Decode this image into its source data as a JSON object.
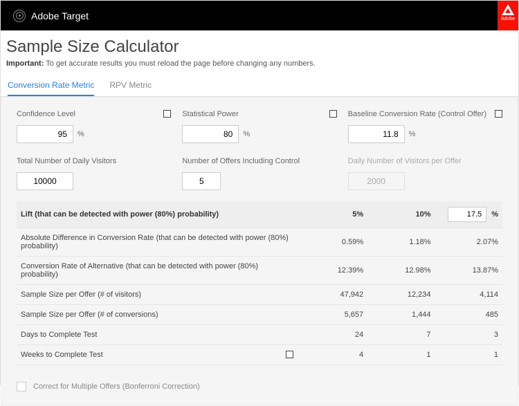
{
  "header": {
    "brand": "Adobe Target",
    "adobe_label": "Adobe"
  },
  "title": "Sample Size Calculator",
  "note_bold": "Important:",
  "note_text": " To get accurate results you must reload the page before changing any numbers.",
  "tabs": {
    "conversion": "Conversion Rate Metric",
    "rpv": "RPV Metric"
  },
  "inputs": {
    "confidence": {
      "label": "Confidence Level",
      "value": "95",
      "unit": "%"
    },
    "power": {
      "label": "Statistical Power",
      "value": "80",
      "unit": "%"
    },
    "baseline": {
      "label": "Baseline Conversion Rate (Control Offer)",
      "value": "11.8",
      "unit": "%"
    },
    "daily": {
      "label": "Total Number of Daily Visitors",
      "value": "10000"
    },
    "offers": {
      "label": "Number of Offers Including Control",
      "value": "5"
    },
    "perOffer": {
      "label": "Daily Number of Visitors per Offer",
      "value": "2000"
    }
  },
  "tableHeader": {
    "lift": "Lift (that can be detected with power (80%) probability)",
    "col5": "5%",
    "col10": "10%",
    "colCustom": "17.5",
    "colCustomUnit": "%"
  },
  "rows": {
    "absdiff": {
      "label": "Absolute Difference in Conversion Rate (that can be detected with power (80%) probability)",
      "v5": "0.59%",
      "v10": "1.18%",
      "vc": "2.07%"
    },
    "convAlt": {
      "label": "Conversion Rate of Alternative (that can be detected with power (80%) probability)",
      "v5": "12.39%",
      "v10": "12.98%",
      "vc": "13.87%"
    },
    "ssVis": {
      "label": "Sample Size per Offer (# of visitors)",
      "v5": "47,942",
      "v10": "12,234",
      "vc": "4,114"
    },
    "ssConv": {
      "label": "Sample Size per Offer (# of conversions)",
      "v5": "5,657",
      "v10": "1,444",
      "vc": "485"
    },
    "days": {
      "label": "Days to Complete Test",
      "v5": "24",
      "v10": "7",
      "vc": "3"
    },
    "weeks": {
      "label": "Weeks to Complete Test",
      "v5": "4",
      "v10": "1",
      "vc": "1"
    }
  },
  "correction": "Correct for Multiple Offers (Bonferroni Correction)"
}
